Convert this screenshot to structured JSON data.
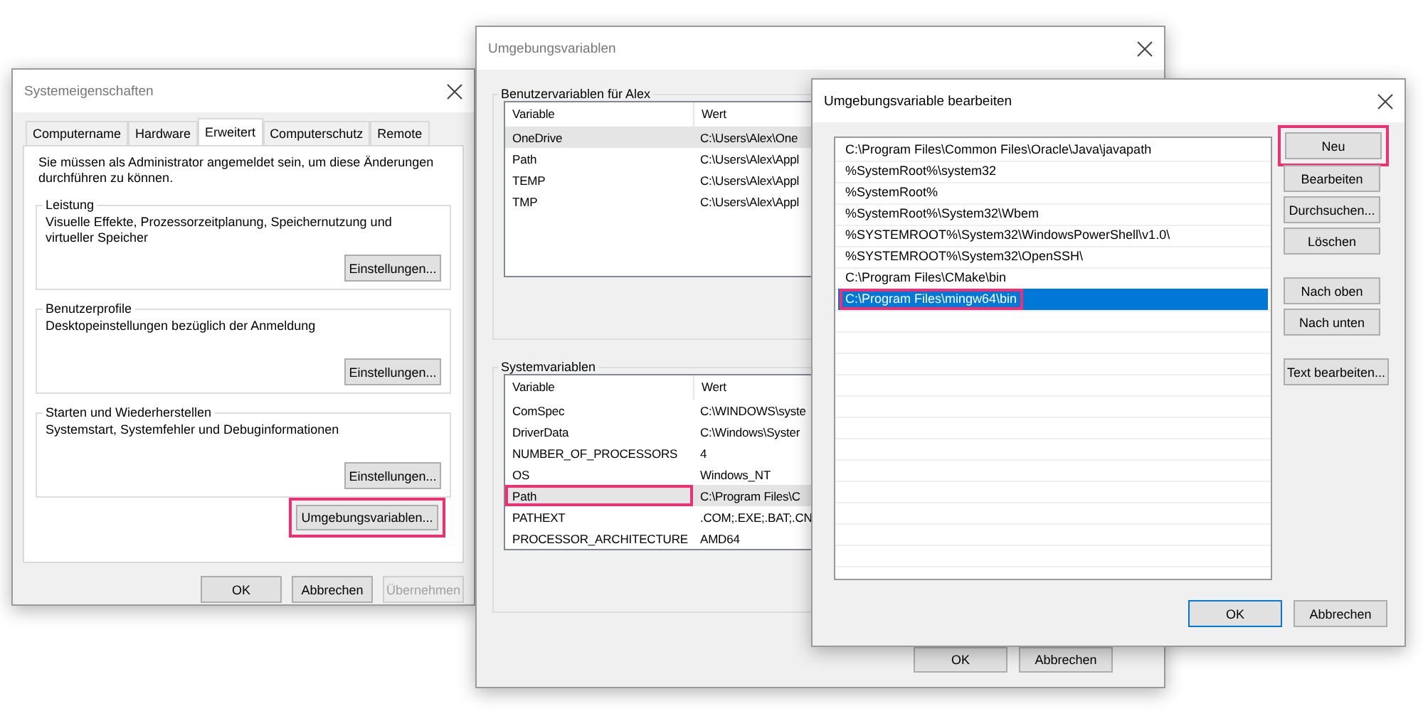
{
  "system_properties": {
    "title": "Systemeigenschaften",
    "tabs": [
      {
        "label": "Computername",
        "selected": false
      },
      {
        "label": "Hardware",
        "selected": false
      },
      {
        "label": "Erweitert",
        "selected": true
      },
      {
        "label": "Computerschutz",
        "selected": false
      },
      {
        "label": "Remote",
        "selected": false
      }
    ],
    "notice": "Sie müssen als Administrator angemeldet sein, um diese Änderungen durchführen zu können.",
    "groups": [
      {
        "title": "Leistung",
        "description": "Visuelle Effekte, Prozessorzeitplanung, Speichernutzung und virtueller Speicher",
        "button": "Einstellungen..."
      },
      {
        "title": "Benutzerprofile",
        "description": "Desktopeinstellungen bezüglich der Anmeldung",
        "button": "Einstellungen..."
      },
      {
        "title": "Starten und Wiederherstellen",
        "description": "Systemstart, Systemfehler und Debuginformationen",
        "button": "Einstellungen..."
      }
    ],
    "env_button": {
      "label": "Umgebungsvariablen...",
      "highlighted": true
    },
    "buttons": [
      {
        "label": "OK",
        "disabled": false
      },
      {
        "label": "Abbrechen",
        "disabled": false
      },
      {
        "label": "Übernehmen",
        "disabled": true
      }
    ]
  },
  "environment_variables": {
    "title": "Umgebungsvariablen",
    "user_group": {
      "title": "Benutzervariablen für Alex",
      "columns": [
        "Variable",
        "Wert"
      ],
      "rows": [
        {
          "variable": "OneDrive",
          "value": "C:\\Users\\Alex\\One",
          "selected": true,
          "highlighted": false
        },
        {
          "variable": "Path",
          "value": "C:\\Users\\Alex\\Appl",
          "selected": false,
          "highlighted": false
        },
        {
          "variable": "TEMP",
          "value": "C:\\Users\\Alex\\Appl",
          "selected": false,
          "highlighted": false
        },
        {
          "variable": "TMP",
          "value": "C:\\Users\\Alex\\Appl",
          "selected": false,
          "highlighted": false
        }
      ]
    },
    "system_group": {
      "title": "Systemvariablen",
      "columns": [
        "Variable",
        "Wert"
      ],
      "rows": [
        {
          "variable": "ComSpec",
          "value": "C:\\WINDOWS\\syste",
          "selected": false,
          "highlighted": false
        },
        {
          "variable": "DriverData",
          "value": "C:\\Windows\\Syster",
          "selected": false,
          "highlighted": false
        },
        {
          "variable": "NUMBER_OF_PROCESSORS",
          "value": "4",
          "selected": false,
          "highlighted": false
        },
        {
          "variable": "OS",
          "value": "Windows_NT",
          "selected": false,
          "highlighted": false
        },
        {
          "variable": "Path",
          "value": "C:\\Program Files\\C",
          "selected": true,
          "highlighted": true
        },
        {
          "variable": "PATHEXT",
          "value": ".COM;.EXE;.BAT;.CN",
          "selected": false,
          "highlighted": false
        },
        {
          "variable": "PROCESSOR_ARCHITECTURE",
          "value": "AMD64",
          "selected": false,
          "highlighted": false
        }
      ]
    },
    "buttons": [
      {
        "label": "OK"
      },
      {
        "label": "Abbrechen"
      }
    ]
  },
  "edit_variable": {
    "title": "Umgebungsvariable bearbeiten",
    "entries": [
      {
        "text": "C:\\Program Files\\Common Files\\Oracle\\Java\\javapath",
        "selected": false,
        "highlighted": false
      },
      {
        "text": "%SystemRoot%\\system32",
        "selected": false,
        "highlighted": false
      },
      {
        "text": "%SystemRoot%",
        "selected": false,
        "highlighted": false
      },
      {
        "text": "%SystemRoot%\\System32\\Wbem",
        "selected": false,
        "highlighted": false
      },
      {
        "text": "%SYSTEMROOT%\\System32\\WindowsPowerShell\\v1.0\\",
        "selected": false,
        "highlighted": false
      },
      {
        "text": "%SYSTEMROOT%\\System32\\OpenSSH\\",
        "selected": false,
        "highlighted": false
      },
      {
        "text": "C:\\Program Files\\CMake\\bin",
        "selected": false,
        "highlighted": false
      },
      {
        "text": "C:\\Program Files\\mingw64\\bin",
        "selected": true,
        "highlighted": true
      }
    ],
    "side_button_groups": [
      [
        {
          "label": "Neu",
          "highlighted": true
        },
        {
          "label": "Bearbeiten",
          "highlighted": false
        },
        {
          "label": "Durchsuchen...",
          "highlighted": false
        },
        {
          "label": "Löschen",
          "highlighted": false
        }
      ],
      [
        {
          "label": "Nach oben",
          "highlighted": false
        },
        {
          "label": "Nach unten",
          "highlighted": false
        }
      ],
      [
        {
          "label": "Text bearbeiten...",
          "highlighted": false
        }
      ]
    ],
    "buttons": [
      {
        "label": "OK",
        "default": true
      },
      {
        "label": "Abbrechen",
        "default": false
      }
    ]
  }
}
